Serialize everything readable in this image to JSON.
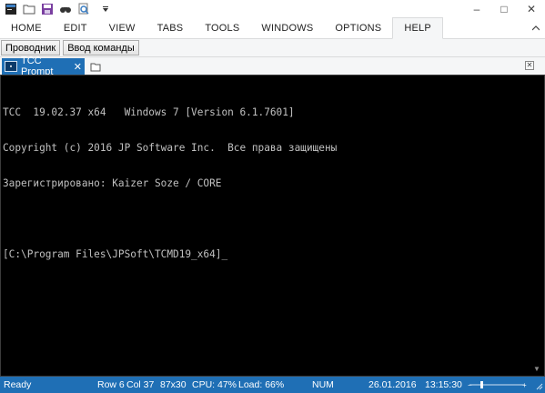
{
  "window": {
    "minimize": "–",
    "maximize": "□",
    "close": "✕"
  },
  "quick_access": [
    {
      "icon": "app-icon"
    },
    {
      "icon": "folder-icon"
    },
    {
      "icon": "save-icon"
    },
    {
      "icon": "binoculars-icon"
    },
    {
      "icon": "search-icon"
    },
    {
      "icon": "dropdown-arrow-icon"
    }
  ],
  "menu": {
    "items": [
      "HOME",
      "EDIT",
      "VIEW",
      "TABS",
      "TOOLS",
      "WINDOWS",
      "OPTIONS",
      "HELP"
    ],
    "active": "HELP"
  },
  "toolbar": {
    "explorer_label": "Проводник",
    "command_input_label": "Ввод команды"
  },
  "tabs": {
    "active_label": "TCC Prompt",
    "close": "✕"
  },
  "console": {
    "lines": [
      "TCC  19.02.37 x64   Windows 7 [Version 6.1.7601]",
      "Copyright (c) 2016 JP Software Inc.  Все права защищены",
      "Зарегистрировано: Kaizer Soze / CORE",
      "",
      "[C:\\Program Files\\JPSoft\\TCMD19_x64]_"
    ]
  },
  "status": {
    "ready": "Ready",
    "row": "Row 6",
    "col": "Col 37",
    "size": "87x30",
    "cpu": "CPU: 47%",
    "load": "Load: 66%",
    "num": "NUM",
    "date": "26.01.2016",
    "time": "13:15:30"
  },
  "colors": {
    "accent": "#1f6fb5",
    "console_bg": "#000000",
    "console_fg": "#c0c0c0"
  }
}
